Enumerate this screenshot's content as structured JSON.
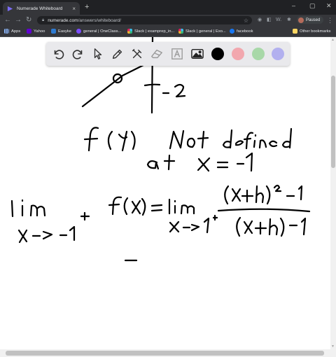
{
  "browser": {
    "tab_title": "Numerade Whiteboard",
    "tab_close": "×",
    "new_tab": "+",
    "window_controls": [
      "–",
      "▢",
      "✕"
    ],
    "url_domain": "numerade.com",
    "url_path": "/answers/whiteboard/",
    "profile_label": "Paused",
    "extension_label": "W.",
    "bookmarks": [
      {
        "label": "Apps",
        "color": "#8ab4f8"
      },
      {
        "label": "Yahoo",
        "color": "#6001d2"
      },
      {
        "label": "Easyke",
        "color": "#2e7bd1"
      },
      {
        "label": "general | OneClass...",
        "color": "#7c4dff"
      },
      {
        "label": "Slack | examprep_in...",
        "color": "#e01e5a"
      },
      {
        "label": "Slack | general | Exo...",
        "color": "#e01e5a"
      },
      {
        "label": "facebook",
        "color": "#1877f2"
      }
    ],
    "other_bookmarks": "Other bookmarks"
  },
  "toolbar": {
    "tools": [
      "undo-icon",
      "redo-icon",
      "pointer-icon",
      "pen-icon",
      "tools-icon",
      "eraser-icon",
      "text-icon",
      "image-icon"
    ],
    "colors": [
      "#000000",
      "#f2a7ae",
      "#a8d8a8",
      "#b2b0ef"
    ],
    "selected_color": "#000000"
  }
}
